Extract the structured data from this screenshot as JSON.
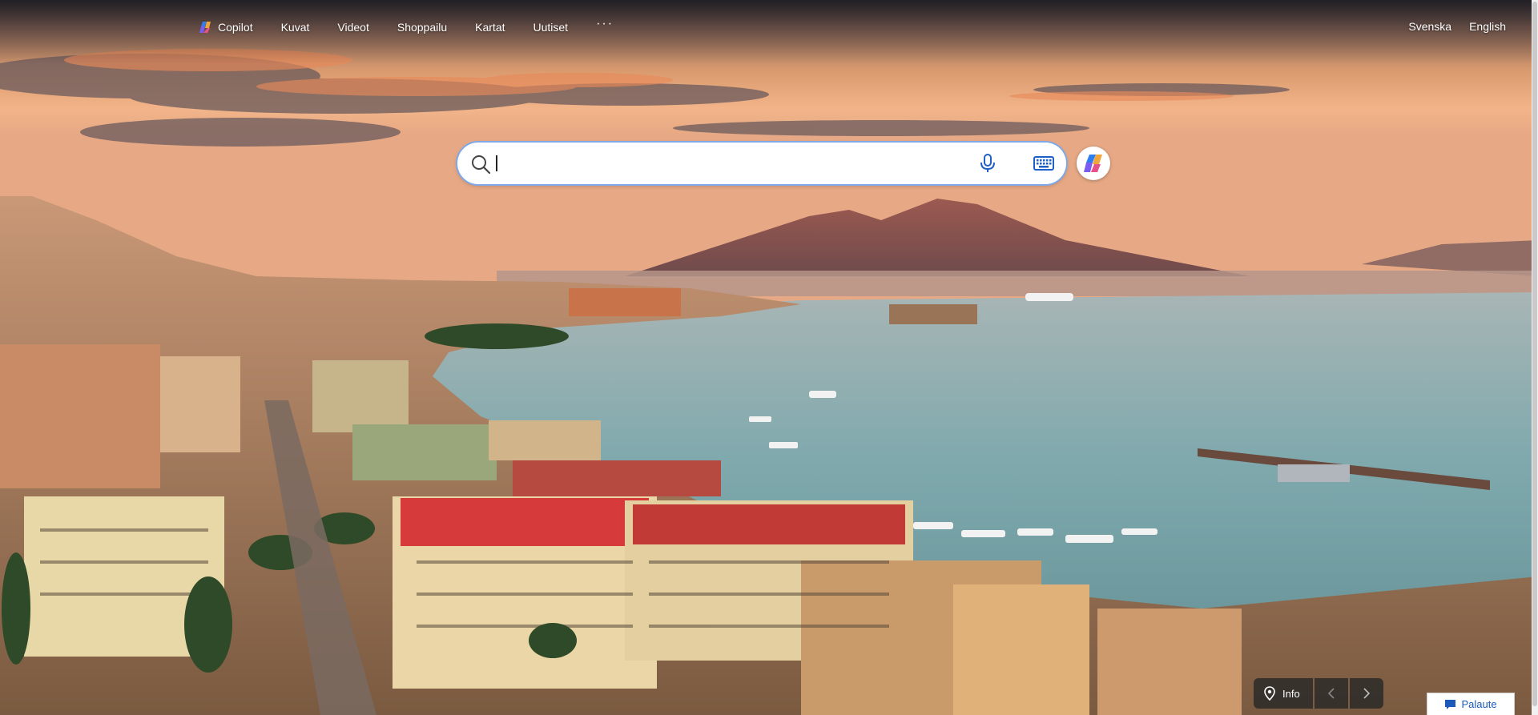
{
  "nav": {
    "items": [
      {
        "label": "Copilot",
        "icon": "copilot-icon"
      },
      {
        "label": "Kuvat"
      },
      {
        "label": "Videot"
      },
      {
        "label": "Shoppailu"
      },
      {
        "label": "Kartat"
      },
      {
        "label": "Uutiset"
      }
    ],
    "more": "···"
  },
  "languages": [
    "Svenska",
    "English"
  ],
  "search": {
    "value": "",
    "icons": [
      "search-icon",
      "microphone-icon",
      "keyboard-icon"
    ]
  },
  "copilot_button": {
    "icon": "copilot-icon"
  },
  "image_controls": {
    "info_label": "Info",
    "icons": [
      "location-pin-icon",
      "chevron-left-icon",
      "chevron-right-icon"
    ]
  },
  "feedback": {
    "label": "Palaute",
    "icon": "chat-bubble-icon"
  },
  "colors": {
    "search_border": "#7fa8e8",
    "feedback_text": "#1b5ab8",
    "sky_top": "#5a4a55",
    "sky_glow": "#f0a070",
    "sea": "#7fa9ad"
  }
}
